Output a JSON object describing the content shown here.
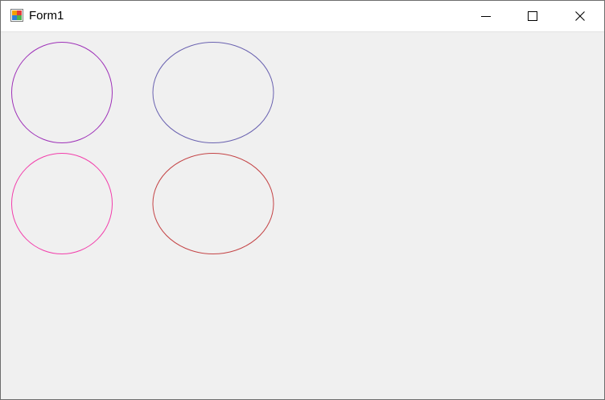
{
  "window": {
    "title": "Form1",
    "icons": {
      "app": "form-app-icon",
      "minimize": "minimize-icon",
      "maximize": "maximize-icon",
      "close": "close-icon"
    }
  },
  "client": {
    "shapes": [
      {
        "name": "purple-circle",
        "kind": "circle",
        "stroke": "#9e31b8"
      },
      {
        "name": "slate-blue-ellipse",
        "kind": "ellipse",
        "stroke": "#6a62b0"
      },
      {
        "name": "pink-circle",
        "kind": "circle",
        "stroke": "#f23eab"
      },
      {
        "name": "red-ellipse",
        "kind": "ellipse",
        "stroke": "#c44446"
      }
    ]
  }
}
